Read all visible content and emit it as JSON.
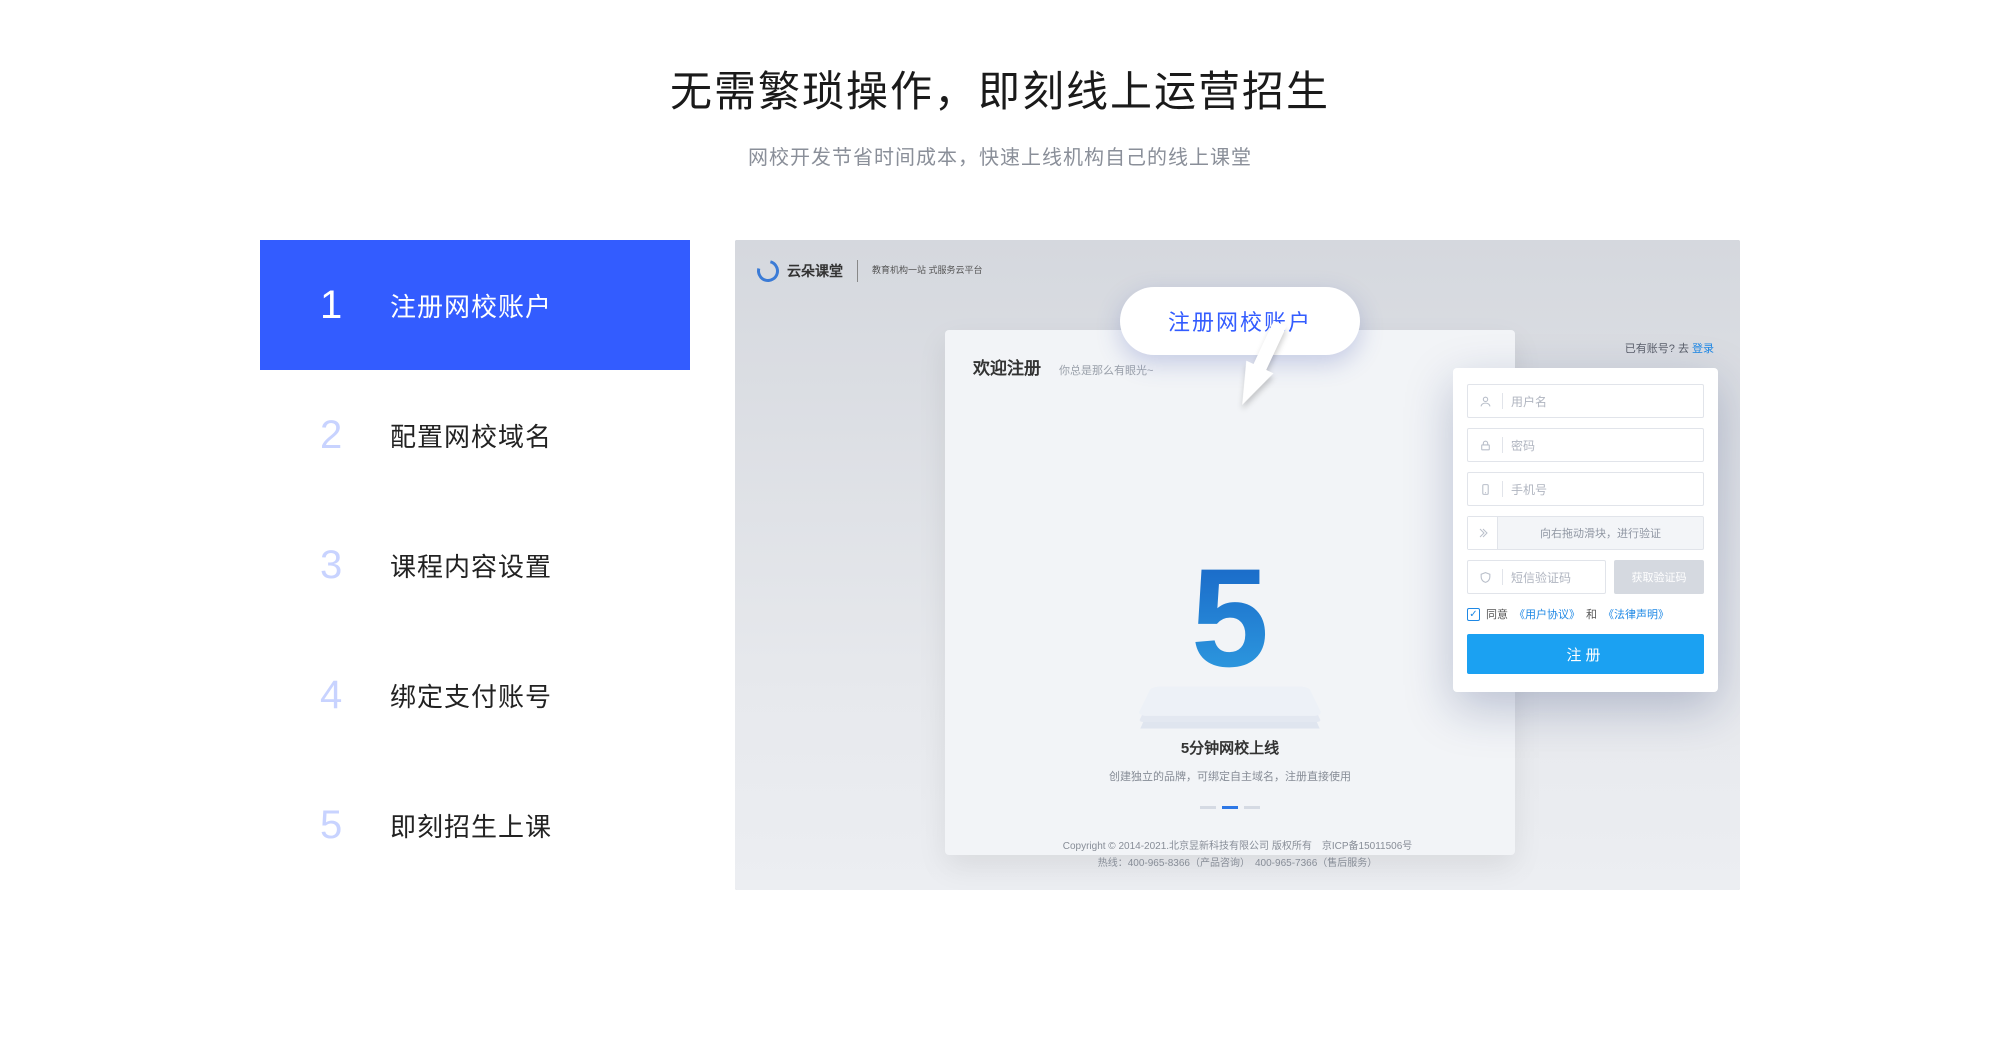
{
  "header": {
    "title": "无需繁琐操作，即刻线上运营招生",
    "subtitle": "网校开发节省时间成本，快速上线机构自己的线上课堂"
  },
  "steps": [
    {
      "num": "1",
      "label": "注册网校账户",
      "active": true
    },
    {
      "num": "2",
      "label": "配置网校域名",
      "active": false
    },
    {
      "num": "3",
      "label": "课程内容设置",
      "active": false
    },
    {
      "num": "4",
      "label": "绑定支付账号",
      "active": false
    },
    {
      "num": "5",
      "label": "即刻招生上课",
      "active": false
    }
  ],
  "preview": {
    "logo": {
      "name": "云朵课堂",
      "tagline": "教育机构一站\n式服务云平台"
    },
    "bubble": "注册网校账户",
    "login_line": {
      "text": "已有账号? 去 ",
      "link": "登录"
    },
    "card": {
      "title": "欢迎注册",
      "subtitle": "你总是那么有眼光~",
      "big_number": "5",
      "caption": "5分钟网校上线",
      "caption_sub": "创建独立的品牌，可绑定自主域名，注册直接使用"
    },
    "form": {
      "username_ph": "用户名",
      "password_ph": "密码",
      "phone_ph": "手机号",
      "slider_text": "向右拖动滑块，进行验证",
      "code_ph": "短信验证码",
      "code_btn": "获取验证码",
      "agree_text": "同意",
      "agree_user": "《用户协议》",
      "agree_and": "和",
      "agree_legal": "《法律声明》",
      "submit": "注册"
    },
    "footer": {
      "line1": "Copyright © 2014-2021.北京昱新科技有限公司 版权所有　京ICP备15011506号",
      "line2": "热线：400-965-8366（产品咨询）　400-965-7366（售后服务）"
    }
  }
}
